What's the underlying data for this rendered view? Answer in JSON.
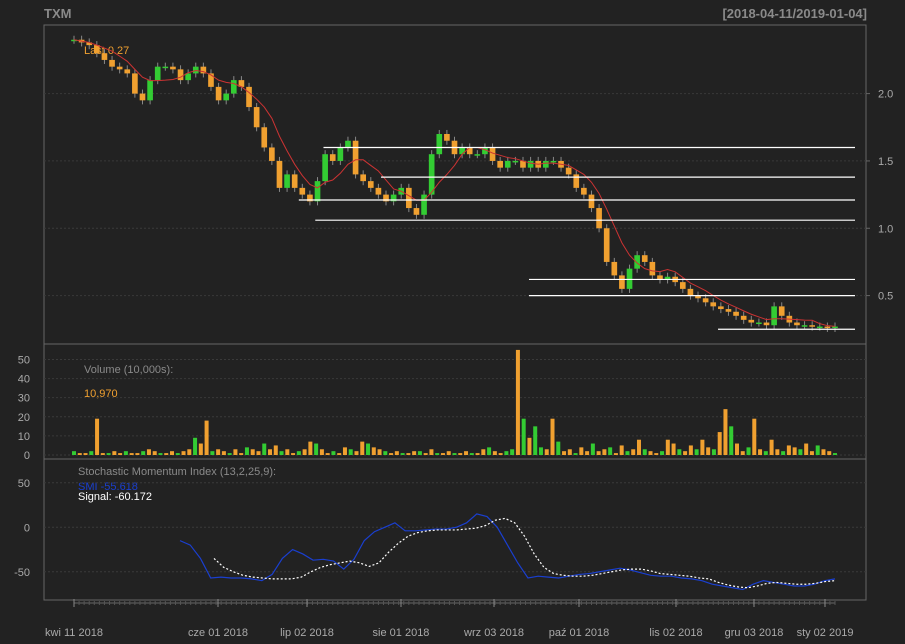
{
  "header": {
    "symbol": "TXM",
    "range": "[2018-04-11/2019-01-04]"
  },
  "price_panel": {
    "last_label": "Last 0.27"
  },
  "volume_panel": {
    "title": "Volume (10,000s):",
    "last_value": "10,970"
  },
  "smi_panel": {
    "title": "Stochastic Momentum Index (13,2,25,9):",
    "smi_label": "SMI -55.618",
    "signal_label": "Signal: -60.172"
  },
  "colors": {
    "background": "#222222",
    "panel_border": "#666666",
    "grid": "#3a3a3a",
    "up": "#33cc33",
    "down": "#f0a030",
    "ma": "#cc3333",
    "smi": "#1a3fd0",
    "signal": "#ffffff",
    "last_text": "#f0a030",
    "axis_text": "#aaaaaa",
    "lines": "#ffffff"
  },
  "chart_data": [
    {
      "type": "candlestick",
      "series": [
        {
          "name": "price",
          "start": "2018-04-11",
          "points": [
            2.4,
            2.38,
            2.36,
            2.3,
            2.25,
            2.2,
            2.18,
            2.15,
            2.0,
            1.95,
            2.1,
            2.2,
            2.2,
            2.18,
            2.1,
            2.15,
            2.2,
            2.15,
            2.05,
            1.95,
            2.0,
            2.1,
            2.05,
            1.9,
            1.75,
            1.6,
            1.5,
            1.3,
            1.4,
            1.3,
            1.25,
            1.2,
            1.35,
            1.55,
            1.5,
            1.6,
            1.65,
            1.4,
            1.35,
            1.3,
            1.25,
            1.2,
            1.25,
            1.3,
            1.15,
            1.1,
            1.25,
            1.55,
            1.7,
            1.65,
            1.55,
            1.6,
            1.55,
            1.55,
            1.6,
            1.5,
            1.45,
            1.5,
            1.5,
            1.45,
            1.5,
            1.45,
            1.5,
            1.5,
            1.45,
            1.4,
            1.3,
            1.25,
            1.15,
            1.0,
            0.75,
            0.65,
            0.55,
            0.7,
            0.8,
            0.75,
            0.65,
            0.62,
            0.64,
            0.6,
            0.55,
            0.5,
            0.48,
            0.45,
            0.42,
            0.4,
            0.38,
            0.35,
            0.32,
            0.3,
            0.3,
            0.28,
            0.42,
            0.35,
            0.3,
            0.28,
            0.28,
            0.27,
            0.27,
            0.26,
            0.27
          ]
        }
      ],
      "horizontal_lines": [
        1.6,
        1.38,
        1.21,
        1.06,
        0.62,
        0.5,
        0.25
      ],
      "moving_average_color": "red",
      "yticks": [
        0.5,
        1.0,
        1.5,
        2.0
      ],
      "ylim": [
        0.2,
        2.45
      ]
    },
    {
      "type": "bar",
      "title": "Volume (10,000s):",
      "series": [
        {
          "name": "volume",
          "values": [
            2,
            1,
            1,
            2,
            19,
            1,
            1,
            2,
            1,
            2,
            1,
            1,
            2,
            3,
            2,
            1,
            1,
            2,
            1,
            2,
            3,
            9,
            6,
            18,
            2,
            3,
            2,
            1,
            3,
            1,
            4,
            3,
            2,
            6,
            3,
            5,
            2,
            3,
            1,
            2,
            3,
            7,
            6,
            3,
            1,
            2,
            1,
            4,
            3,
            2,
            7,
            6,
            4,
            3,
            2,
            1,
            2,
            1,
            1,
            2,
            2,
            1,
            3,
            1,
            1,
            2,
            1,
            1,
            2,
            1,
            1,
            3,
            4,
            2,
            1,
            2,
            3,
            55,
            19,
            9,
            15,
            4,
            3,
            19,
            7,
            2,
            3,
            1,
            4,
            2,
            6,
            2,
            3,
            4,
            1,
            5,
            2,
            3,
            8,
            3,
            2,
            1,
            2,
            8,
            6,
            3,
            2,
            5,
            3,
            8,
            4,
            3,
            12,
            24,
            15,
            6,
            2,
            4,
            19,
            3,
            2,
            8,
            3,
            2,
            5,
            4,
            3,
            6,
            2,
            5,
            3,
            2,
            1
          ]
        }
      ],
      "yticks": [
        0,
        10,
        20,
        30,
        40,
        50
      ],
      "ylim": [
        0,
        56
      ]
    },
    {
      "type": "line",
      "title": "Stochastic Momentum Index (13,2,25,9):",
      "series": [
        {
          "name": "SMI",
          "values": [
            -15,
            -20,
            -35,
            -57,
            -56,
            -57,
            -57,
            -58,
            -60,
            -53,
            -35,
            -25,
            -30,
            -37,
            -36,
            -38,
            -47,
            -36,
            -15,
            -5,
            0,
            5,
            -4,
            -4,
            -3,
            -2,
            -2,
            0,
            5,
            15,
            12,
            0,
            -20,
            -40,
            -57,
            -55,
            -56,
            -57,
            -55,
            -53,
            -52,
            -50,
            -48,
            -46,
            -48,
            -51,
            -54,
            -55,
            -55,
            -57,
            -58,
            -60,
            -64,
            -66,
            -68,
            -70,
            -64,
            -60,
            -62,
            -64,
            -66,
            -66,
            -64,
            -60,
            -58
          ]
        },
        {
          "name": "Signal",
          "values": [
            -35,
            -45,
            -50,
            -54,
            -56,
            -57,
            -58,
            -58,
            -58,
            -56,
            -50,
            -45,
            -42,
            -40,
            -38,
            -40,
            -44,
            -40,
            -28,
            -18,
            -10,
            -6,
            -4,
            -3,
            -3,
            -3,
            -2,
            -1,
            2,
            8,
            10,
            5,
            -10,
            -30,
            -45,
            -52,
            -54,
            -55,
            -55,
            -54,
            -52,
            -50,
            -48,
            -47,
            -47,
            -49,
            -52,
            -53,
            -54,
            -55,
            -57,
            -58,
            -62,
            -65,
            -67,
            -68,
            -66,
            -63,
            -62,
            -63,
            -64,
            -64,
            -63,
            -61,
            -60
          ]
        }
      ],
      "yticks": [
        -50,
        0,
        50
      ],
      "ylim": [
        -75,
        70
      ]
    }
  ],
  "x_ticks": [
    "kwi 11 2018",
    "cze 01 2018",
    "lip 02 2018",
    "sie 01 2018",
    "wrz 03 2018",
    "paź 01 2018",
    "lis 02 2018",
    "gru 03 2018",
    "sty 02 2019"
  ]
}
